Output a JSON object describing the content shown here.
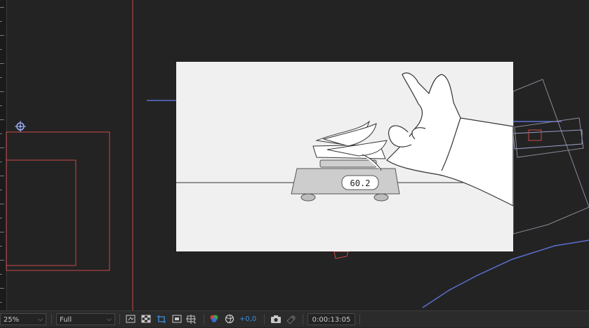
{
  "composition": {
    "scale_readout": "60.2"
  },
  "toolbar": {
    "zoom_value": "25%",
    "resolution_value": "Full",
    "exposure_value": "+0,0",
    "timecode": "0:00:13:05"
  },
  "icons": {
    "zoom_dropdown": "chevron-down-icon",
    "resolution_dropdown": "chevron-down-icon",
    "fast_previews": "fast-previews-icon",
    "transparency_grid": "transparency-grid-icon",
    "region_of_interest": "region-of-interest-icon",
    "mask_visibility": "mask-visibility-icon",
    "guides": "guides-icon",
    "channels": "color-channels-icon",
    "color_management": "color-management-icon",
    "snapshot": "camera-icon",
    "show_snapshot": "show-snapshot-icon"
  },
  "colors": {
    "panel_bg": "#232323",
    "layer_outline_red": "#c84a4a",
    "guide_line_blue": "#5b6fd0",
    "accent_blue": "#3d8ee0",
    "comp_bg": "#f0f0f0"
  }
}
